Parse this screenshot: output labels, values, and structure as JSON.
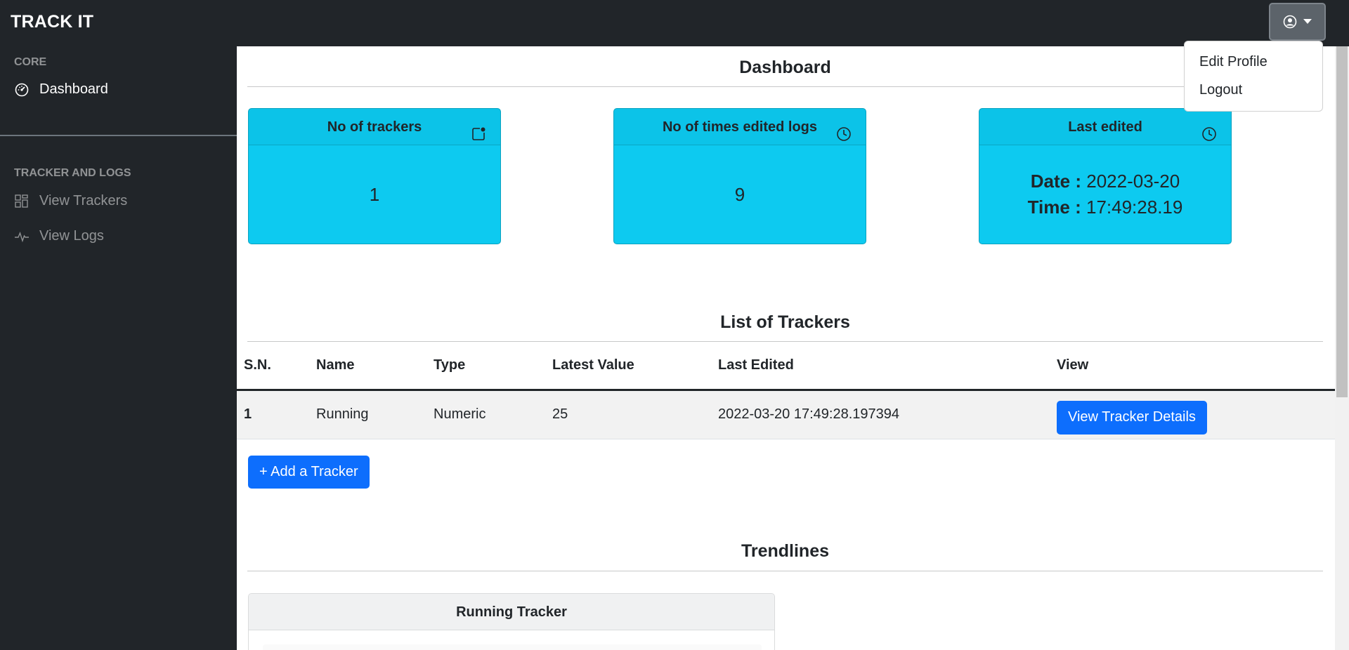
{
  "navbar": {
    "brand": "TRACK IT",
    "user_menu": {
      "items": [
        "Edit Profile",
        "Logout"
      ]
    }
  },
  "sidebar": {
    "sections": [
      {
        "heading": "CORE",
        "items": [
          {
            "label": "Dashboard",
            "icon": "speedometer-icon",
            "active": true
          }
        ]
      },
      {
        "heading": "TRACKER AND LOGS",
        "items": [
          {
            "label": "View Trackers",
            "icon": "grid-icon",
            "active": false
          },
          {
            "label": "View Logs",
            "icon": "activity-icon",
            "active": false
          }
        ]
      }
    ]
  },
  "dashboard": {
    "title": "Dashboard",
    "cards": [
      {
        "title": "No of trackers",
        "icon": "notification-box-icon",
        "value": "1"
      },
      {
        "title": "No of times edited logs",
        "icon": "clock-icon",
        "value": "9"
      },
      {
        "title": "Last edited",
        "icon": "clock-icon",
        "date_label": "Date :",
        "date_value": "2022-03-20",
        "time_label": "Time :",
        "time_value": "17:49:28.19"
      }
    ]
  },
  "trackers": {
    "title": "List of Trackers",
    "columns": [
      "S.N.",
      "Name",
      "Type",
      "Latest Value",
      "Last Edited",
      "View"
    ],
    "rows": [
      {
        "sn": "1",
        "name": "Running",
        "type": "Numeric",
        "latest_value": "25",
        "last_edited": "2022-03-20 17:49:28.197394",
        "action": "View Tracker Details"
      }
    ],
    "add_button": "+ Add a Tracker"
  },
  "trendlines": {
    "title": "Trendlines",
    "cards": [
      {
        "title": "Running Tracker"
      }
    ]
  },
  "colors": {
    "navbar_bg": "#212529",
    "card_bg": "#0dcaf0",
    "primary": "#0d6efd"
  }
}
